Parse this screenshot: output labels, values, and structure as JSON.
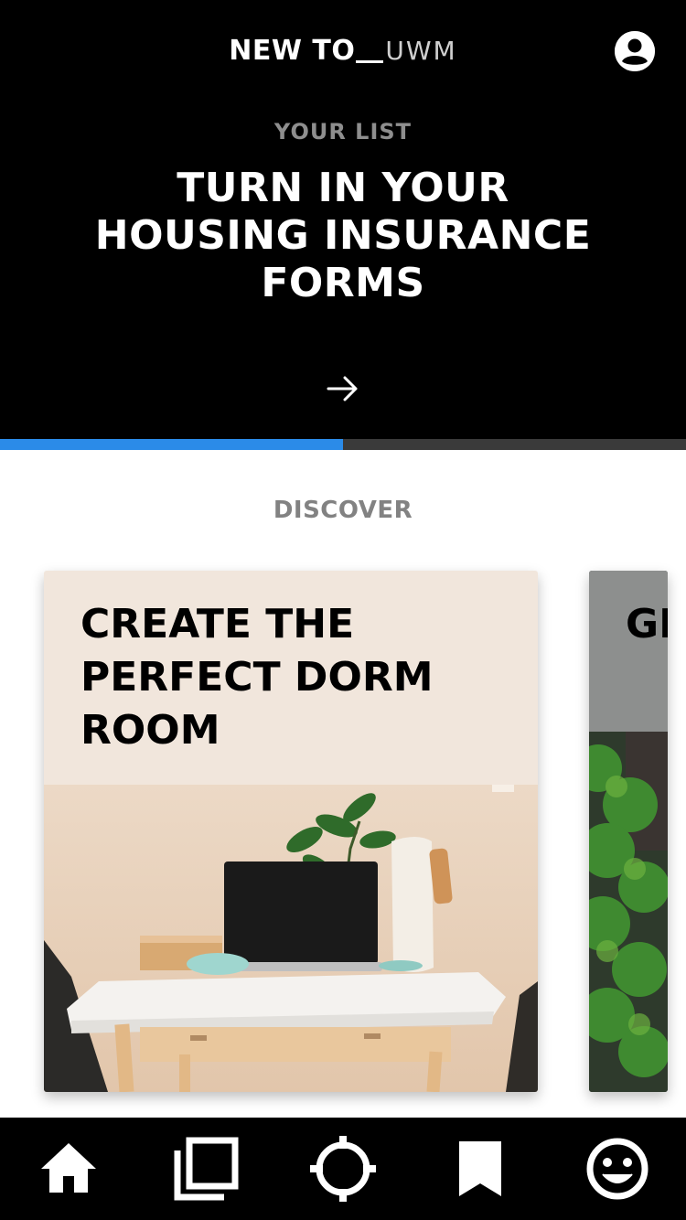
{
  "header": {
    "brand_bold": "NEW TO",
    "brand_light": "UWM",
    "list_label": "YOUR LIST",
    "task_title": "TURN IN YOUR HOUSING INSURANCE FORMS",
    "progress_percent": 50,
    "progress_color": "#2b8be8"
  },
  "discover": {
    "label": "DISCOVER",
    "cards": [
      {
        "title": "CREATE THE PERFECT DORM ROOM"
      },
      {
        "title": "GI UI"
      }
    ]
  },
  "nav": {
    "items": [
      {
        "icon": "home-icon"
      },
      {
        "icon": "library-icon"
      },
      {
        "icon": "locate-icon"
      },
      {
        "icon": "bookmark-icon"
      },
      {
        "icon": "smiley-icon"
      }
    ]
  }
}
